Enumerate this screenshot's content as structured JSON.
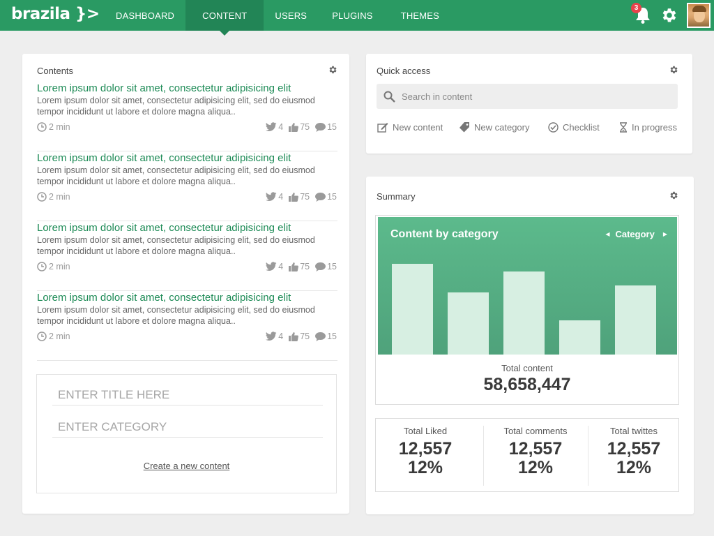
{
  "brand": {
    "logo": "brazila }>"
  },
  "nav": {
    "items": [
      "DASHBOARD",
      "CONTENT",
      "USERS",
      "PLUGINS",
      "THEMES"
    ],
    "active": "CONTENT"
  },
  "header": {
    "notification_count": "3",
    "accent": "#2a9a63"
  },
  "contents": {
    "title": "Contents",
    "articles": [
      {
        "title": "Lorem ipsum dolor sit amet, consectetur adipisicing elit",
        "body": "Lorem ipsum dolor sit amet, consectetur adipisicing elit, sed do eiusmod tempor incididunt ut labore et dolore magna aliqua..",
        "time": "2 min",
        "tweets": "4",
        "likes": "75",
        "comments": "15"
      },
      {
        "title": "Lorem ipsum dolor sit amet, consectetur adipisicing elit",
        "body": "Lorem ipsum dolor sit amet, consectetur adipisicing elit, sed do eiusmod tempor incididunt ut labore et dolore magna aliqua..",
        "time": "2 min",
        "tweets": "4",
        "likes": "75",
        "comments": "15"
      },
      {
        "title": "Lorem ipsum dolor sit amet, consectetur adipisicing elit",
        "body": "Lorem ipsum dolor sit amet, consectetur adipisicing elit, sed do eiusmod tempor incididunt ut labore et dolore magna aliqua..",
        "time": "2 min",
        "tweets": "4",
        "likes": "75",
        "comments": "15"
      },
      {
        "title": "Lorem ipsum dolor sit amet, consectetur adipisicing elit",
        "body": "Lorem ipsum dolor sit amet, consectetur adipisicing elit, sed do eiusmod tempor incididunt ut labore et dolore magna aliqua..",
        "time": "2 min",
        "tweets": "4",
        "likes": "75",
        "comments": "15"
      }
    ],
    "form": {
      "title_placeholder": "ENTER TITLE HERE",
      "category_placeholder": "ENTER CATEGORY",
      "create_link": "Create a new content"
    }
  },
  "quick_access": {
    "title": "Quick access",
    "search_placeholder": "Search in content",
    "actions": [
      {
        "label": "New content",
        "icon": "edit-icon"
      },
      {
        "label": "New category",
        "icon": "tag-icon"
      },
      {
        "label": "Checklist",
        "icon": "check-circle-icon"
      },
      {
        "label": "In progress",
        "icon": "hourglass-icon"
      }
    ]
  },
  "summary": {
    "title": "Summary",
    "total_label": "Total content",
    "total_value": "58,658,447",
    "stats": [
      {
        "label": "Total Liked",
        "value": "12,557",
        "percent": "12%"
      },
      {
        "label": "Total comments",
        "value": "12,557",
        "percent": "12%"
      },
      {
        "label": "Total twittes",
        "value": "12,557",
        "percent": "12%"
      }
    ]
  },
  "chart_data": {
    "type": "bar",
    "title": "Content by category",
    "selector_label": "Category",
    "categories": [
      "",
      "",
      "",
      "",
      ""
    ],
    "values": [
      130,
      89,
      119,
      49,
      99
    ],
    "ylim": [
      0,
      197
    ],
    "bar_color": "#d7efe2",
    "background": "#56ae84"
  }
}
